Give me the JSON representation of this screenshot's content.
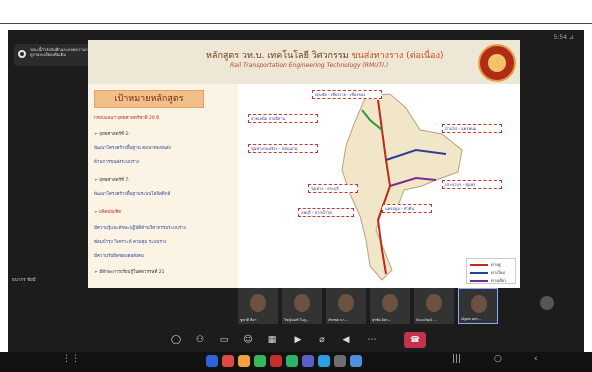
{
  "status": {
    "time": "5:54 ⊿"
  },
  "banner": {
    "text": "ขณะนี้กำลังบันทึกและถอดความการประชุมนี้ โปรดดูการแจ้งข้อมูลความเป็นส่วนตัวเพื่อดูรายละเอียดเพิ่มเติม",
    "close_icon": "×"
  },
  "slide": {
    "title_prefix": "หลักสูตร วท.บ. เทคโนโลยี วิศวกรรม",
    "title_highlight": "ขนส่งทางราง (ต่อเนื่อง)",
    "title_en": "Rail Transportation Engineering Technology (RMUTI.)",
    "objective": "เป้าหมายหลักสูตร",
    "bullets": [
      {
        "text": "กรอบแผนฯ ยุทธศาสตร์ชาติ 20 ปี",
        "style": "red"
      },
      {
        "text": "➢ ยุทธศาสตร์ที่ 2:",
        "style": "plain"
      },
      {
        "text": "พัฒนาโครงสร้างพื้นฐาน คมนาคมขนส่ง",
        "style": "blue"
      },
      {
        "text": "ด้านการขนส่งระบบราง",
        "style": "blue"
      },
      {
        "text": "➢ ยุทธศาสตร์ที่ 7:",
        "style": "plain"
      },
      {
        "text": "พัฒนาโครงสร้างพื้นฐานระบบโลจิสติกส์",
        "style": "blue"
      },
      {
        "text": "➢ ผลิตบัณฑิต",
        "style": "red"
      },
      {
        "text": "มีความรู้และทักษะปฏิบัติด้านวิศวกรรมระบบราง",
        "style": "blue"
      },
      {
        "text": "ซ่อมบำรุง วิเคราะห์ ควบคุม ระบบราง",
        "style": "blue"
      },
      {
        "text": "มีความรับผิดชอบต่อสังคม",
        "style": "blue"
      },
      {
        "text": "➢ มีทักษะการเรียนรู้ในศตวรรษที่ 21",
        "style": "plain"
      }
    ],
    "callouts": [
      "เด่นชัย - เชียงราย - เชียงของ",
      "สายเหนือ สายอีสาน",
      "ชุมทางถนนจิระ - ขอนแก่น",
      "บ้านไผ่ - นครพนม",
      "ชุมทาง - สระบุรี",
      "ลพบุรี - ปากน้ำโพ",
      "นครปฐม - หัวหิน",
      "ประจวบฯ - ชุมพร"
    ],
    "legend": [
      "ทางคู่",
      "ทางใหม่",
      "ทางเดี่ยว"
    ]
  },
  "participants": [
    {
      "name": "ชูชาติ ลือฯ"
    },
    {
      "name": "วิชญ์นนท์ โนภู..."
    },
    {
      "name": "ภัทรพล นา..."
    },
    {
      "name": "สุรชัย อัคร..."
    },
    {
      "name": "ปัณณวัฒน์ ..."
    },
    {
      "name": "ณัฐพล ผลร..."
    }
  ],
  "self_label": "ธนากร ชัยมี",
  "controls": [
    "chat-icon",
    "people-icon",
    "share-icon",
    "react-icon",
    "view-icon",
    "camera-icon",
    "mic-icon",
    "speaker-icon",
    "more-icon"
  ],
  "leave_label": "☎",
  "colors": {
    "accent": "#c4314b",
    "slide_bg": "#fbf3e3"
  }
}
